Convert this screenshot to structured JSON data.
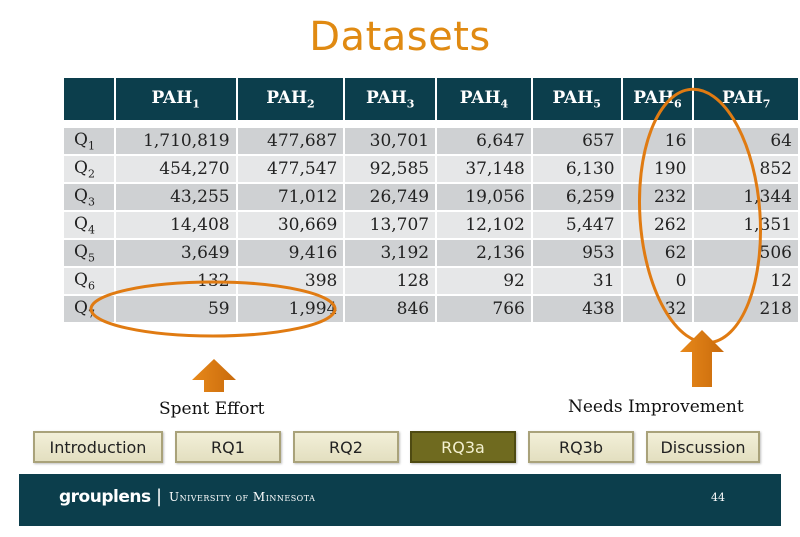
{
  "slide": {
    "title": "Datasets",
    "page_number": "44"
  },
  "table": {
    "columns": [
      {
        "base": "PAH",
        "sub": "1"
      },
      {
        "base": "PAH",
        "sub": "2"
      },
      {
        "base": "PAH",
        "sub": "3"
      },
      {
        "base": "PAH",
        "sub": "4"
      },
      {
        "base": "PAH",
        "sub": "5"
      },
      {
        "base": "PAH",
        "sub": "6"
      },
      {
        "base": "PAH",
        "sub": "7"
      }
    ],
    "rows": [
      {
        "base": "Q",
        "sub": "1",
        "values": [
          "1,710,819",
          "477,687",
          "30,701",
          "6,647",
          "657",
          "16",
          "64"
        ]
      },
      {
        "base": "Q",
        "sub": "2",
        "values": [
          "454,270",
          "477,547",
          "92,585",
          "37,148",
          "6,130",
          "190",
          "852"
        ]
      },
      {
        "base": "Q",
        "sub": "3",
        "values": [
          "43,255",
          "71,012",
          "26,749",
          "19,056",
          "6,259",
          "232",
          "1,344"
        ]
      },
      {
        "base": "Q",
        "sub": "4",
        "values": [
          "14,408",
          "30,669",
          "13,707",
          "12,102",
          "5,447",
          "262",
          "1,351"
        ]
      },
      {
        "base": "Q",
        "sub": "5",
        "values": [
          "3,649",
          "9,416",
          "3,192",
          "2,136",
          "953",
          "62",
          "506"
        ]
      },
      {
        "base": "Q",
        "sub": "6",
        "values": [
          "132",
          "398",
          "128",
          "92",
          "31",
          "0",
          "12"
        ]
      },
      {
        "base": "Q",
        "sub": "7",
        "values": [
          "59",
          "1,994",
          "846",
          "766",
          "438",
          "32",
          "218"
        ]
      }
    ]
  },
  "annotations": {
    "left_label": "Spent Effort",
    "right_label": "Needs Improvement",
    "highlight_color": "#e07b12"
  },
  "nav": {
    "items": [
      {
        "label": "Introduction",
        "active": false
      },
      {
        "label": "RQ1",
        "active": false
      },
      {
        "label": "RQ2",
        "active": false
      },
      {
        "label": "RQ3a",
        "active": true
      },
      {
        "label": "RQ3b",
        "active": false
      },
      {
        "label": "Discussion",
        "active": false
      }
    ]
  },
  "footer": {
    "logo": "grouplens",
    "separator": "|",
    "institution": "University of Minnesota"
  }
}
